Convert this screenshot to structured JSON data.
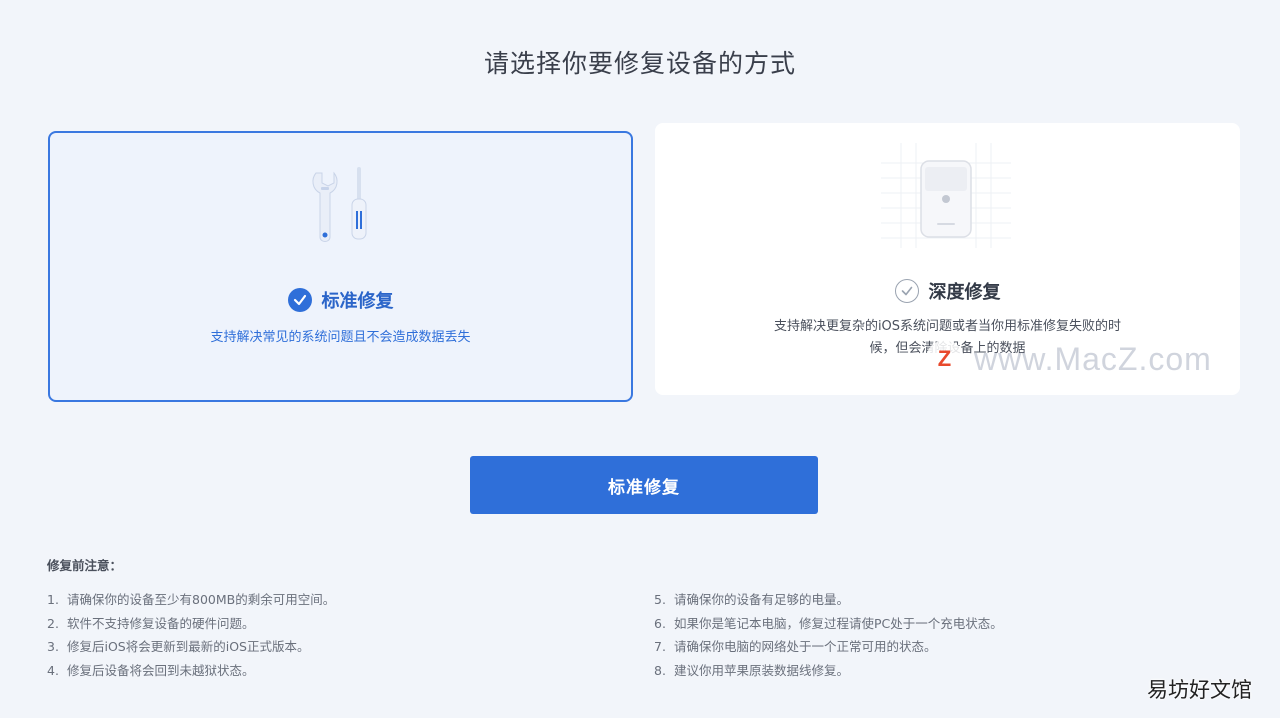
{
  "title": "请选择你要修复设备的方式",
  "options": {
    "standard": {
      "title": "标准修复",
      "description": "支持解决常见的系统问题且不会造成数据丢失",
      "selected": true,
      "icon": "tools-icon"
    },
    "deep": {
      "title": "深度修复",
      "description": "支持解决更复杂的iOS系统问题或者当你用标准修复失败的时候，但会清除设备上的数据",
      "selected": false,
      "icon": "device-icon"
    }
  },
  "primary_button": "标准修复",
  "notes": {
    "title": "修复前注意：",
    "left": [
      {
        "num": "1.",
        "text": "请确保你的设备至少有800MB的剩余可用空间。"
      },
      {
        "num": "2.",
        "text": "软件不支持修复设备的硬件问题。"
      },
      {
        "num": "3.",
        "text": "修复后iOS将会更新到最新的iOS正式版本。"
      },
      {
        "num": "4.",
        "text": "修复后设备将会回到未越狱状态。"
      }
    ],
    "right": [
      {
        "num": "5.",
        "text": "请确保你的设备有足够的电量。"
      },
      {
        "num": "6.",
        "text": "如果你是笔记本电脑，修复过程请使PC处于一个充电状态。"
      },
      {
        "num": "7.",
        "text": "请确保你电脑的网络处于一个正常可用的状态。"
      },
      {
        "num": "8.",
        "text": "建议你用苹果原装数据线修复。"
      }
    ]
  },
  "watermark": {
    "logo": "Z",
    "text": "www.MacZ.com"
  },
  "corner_mark": "易坊好文馆",
  "colors": {
    "accent": "#2f6fd9",
    "selected_bg": "#eef3fc",
    "page_bg": "#f2f5fa"
  }
}
